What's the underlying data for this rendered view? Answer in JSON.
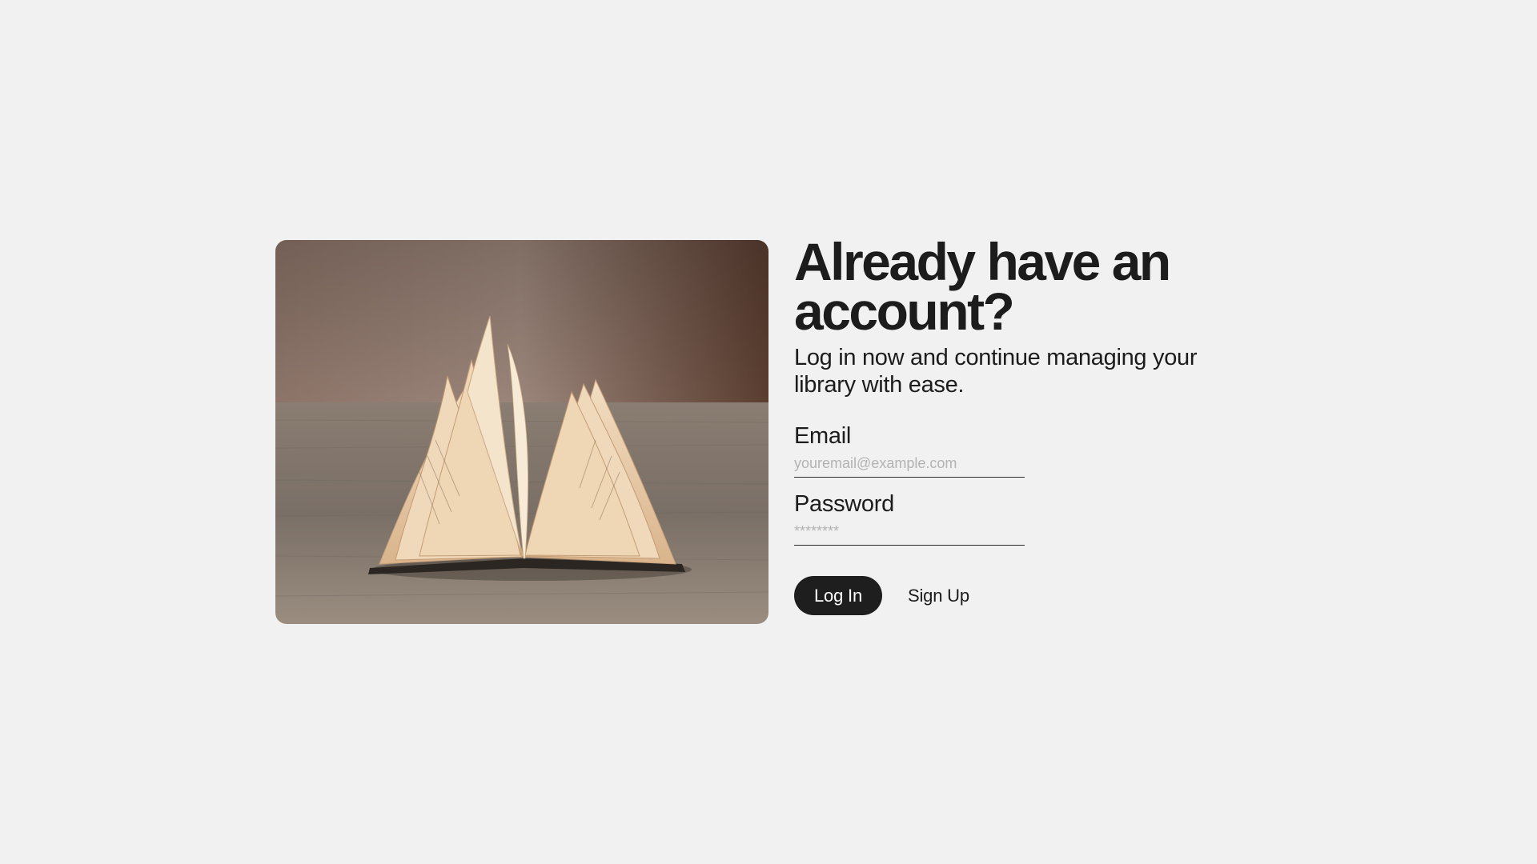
{
  "hero": {
    "image_subject": "open-book-icon"
  },
  "login": {
    "headline": "Already have an account?",
    "subtitle": "Log in now and continue managing your library with ease.",
    "email": {
      "label": "Email",
      "placeholder": "youremail@example.com",
      "value": ""
    },
    "password": {
      "label": "Password",
      "placeholder": "********",
      "value": ""
    },
    "login_button": "Log In",
    "signup_button": "Sign Up"
  },
  "colors": {
    "background": "#f0f1f0",
    "text": "#1c1c1c",
    "primary_button": "#1e1e1e",
    "placeholder": "#b3b3b3"
  }
}
